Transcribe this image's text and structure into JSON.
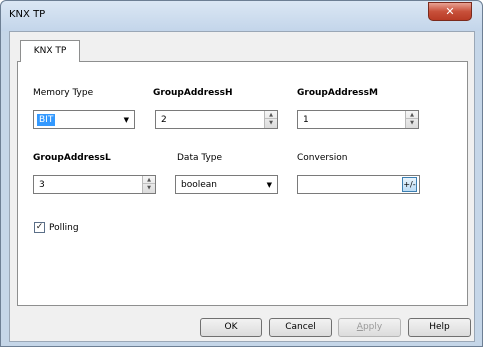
{
  "window": {
    "title": "KNX TP",
    "close_glyph": "✕"
  },
  "tabs": [
    {
      "label": "KNX TP"
    }
  ],
  "form": {
    "memory_type": {
      "label": "Memory Type",
      "value": "BIT"
    },
    "group_address_h": {
      "label": "GroupAddressH",
      "value": "2"
    },
    "group_address_m": {
      "label": "GroupAddressM",
      "value": "1"
    },
    "group_address_l": {
      "label": "GroupAddressL",
      "value": "3"
    },
    "data_type": {
      "label": "Data Type",
      "value": "boolean"
    },
    "conversion": {
      "label": "Conversion",
      "value": "",
      "button_label": "+/-"
    },
    "polling": {
      "label": "Polling",
      "checked": true
    }
  },
  "buttons": {
    "ok": "OK",
    "cancel": "Cancel",
    "apply_first": "A",
    "apply_rest": "pply",
    "help": "Help"
  },
  "icons": {
    "close": "close-icon",
    "dropdown": "chevron-down-icon",
    "spinner": "spinner-icon",
    "checkmark": "checkmark-icon"
  },
  "colors": {
    "titlebar": "#c3d5ea",
    "close_button": "#c8503a",
    "selection": "#3399ff",
    "client_background": "#f0f0f0"
  }
}
